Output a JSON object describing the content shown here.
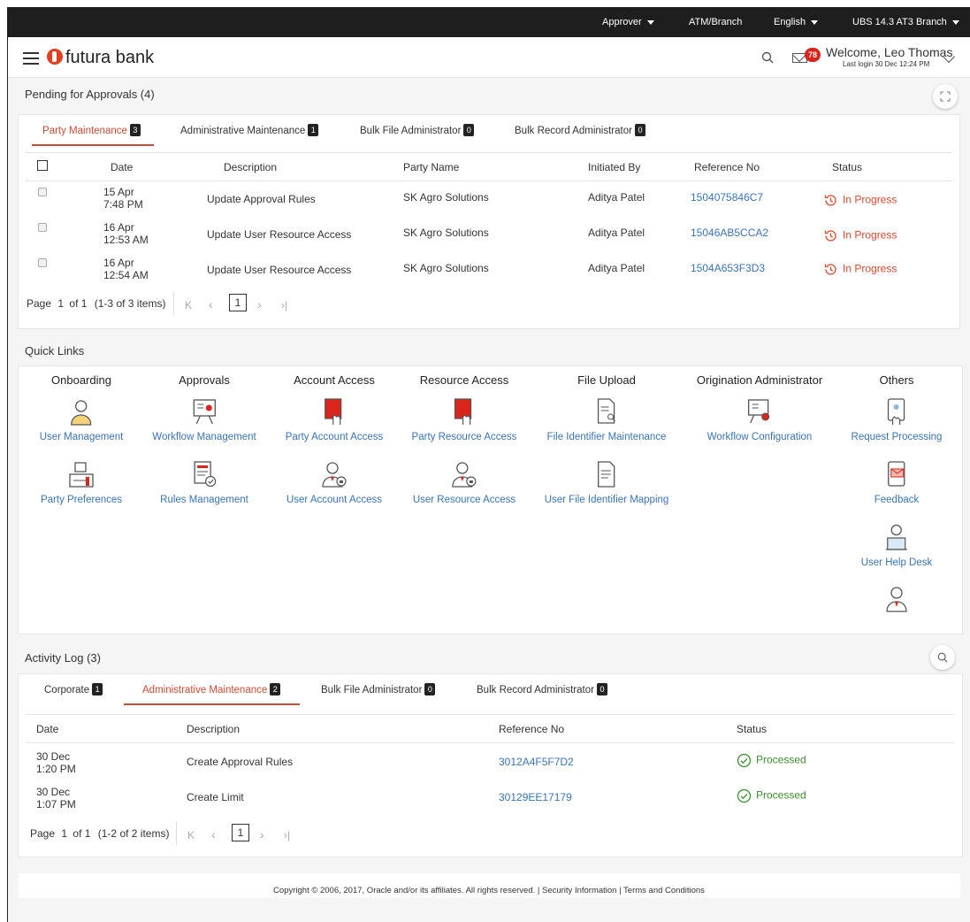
{
  "topbar": {
    "role": "Approver",
    "atm_branch": "ATM/Branch",
    "language": "English",
    "branch": "UBS 14.3 AT3 Branch"
  },
  "header": {
    "brand": "futura bank",
    "notification_count": "78",
    "welcome": "Welcome, Leo Thomas",
    "last_login": "Last login 30 Dec 12:24 PM"
  },
  "pending": {
    "title": "Pending for Approvals (4)",
    "tabs": [
      {
        "label": "Party Maintenance",
        "count": "3"
      },
      {
        "label": "Administrative Maintenance",
        "count": "1"
      },
      {
        "label": "Bulk File Administrator",
        "count": "0"
      },
      {
        "label": "Bulk Record Administrator",
        "count": "0"
      }
    ],
    "columns": [
      "Date",
      "Description",
      "Party Name",
      "Initiated By",
      "Reference No",
      "Status"
    ],
    "rows": [
      {
        "date1": "15 Apr",
        "date2": "7:48 PM",
        "description": "Update Approval Rules",
        "party": "SK Agro Solutions",
        "initiated_by": "Aditya Patel",
        "ref": "1504075846C7",
        "status": "In Progress"
      },
      {
        "date1": "16 Apr",
        "date2": "12:53 AM",
        "description": "Update User Resource Access",
        "party": "SK Agro Solutions",
        "initiated_by": "Aditya Patel",
        "ref": "15046AB5CCA2",
        "status": "In Progress"
      },
      {
        "date1": "16 Apr",
        "date2": "12:54 AM",
        "description": "Update User Resource Access",
        "party": "SK Agro Solutions",
        "initiated_by": "Aditya Patel",
        "ref": "1504A653F3D3",
        "status": "In Progress"
      }
    ],
    "pager": {
      "page_label": "Page",
      "page": "1",
      "of_label": "of 1",
      "items": "(1-3 of 3 items)",
      "current": "1"
    }
  },
  "quick_links": {
    "title": "Quick Links",
    "categories": [
      "Onboarding",
      "Approvals",
      "Account Access",
      "Resource Access",
      "File Upload",
      "Origination Administrator",
      "Others"
    ],
    "items": [
      "User Management",
      "Workflow Management",
      "Party Account Access",
      "Party Resource Access",
      "File Identifier Maintenance",
      "Workflow Configuration",
      "Request Processing",
      "Party Preferences",
      "Rules Management",
      "User Account Access",
      "User Resource Access",
      "User File Identifier Mapping",
      "Feedback",
      "User Help Desk"
    ]
  },
  "activity": {
    "title": "Activity Log (3)",
    "tabs": [
      {
        "label": "Corporate",
        "count": "1"
      },
      {
        "label": "Administrative Maintenance",
        "count": "2"
      },
      {
        "label": "Bulk File Administrator",
        "count": "0"
      },
      {
        "label": "Bulk Record Administrator",
        "count": "0"
      }
    ],
    "columns": [
      "Date",
      "Description",
      "Reference No",
      "Status"
    ],
    "rows": [
      {
        "date1": "30 Dec",
        "date2": "1:20 PM",
        "description": "Create Approval Rules",
        "ref": "3012A4F5F7D2",
        "status": "Processed"
      },
      {
        "date1": "30 Dec",
        "date2": "1:07 PM",
        "description": "Create Limit",
        "ref": "30129EE17179",
        "status": "Processed"
      }
    ],
    "pager": {
      "page_label": "Page",
      "page": "1",
      "of_label": "of 1",
      "items": "(1-2 of 2 items)",
      "current": "1"
    }
  },
  "footer": {
    "text": "Copyright © 2006, 2017, Oracle and/or its affiliates. All rights reserved. | Security Information | Terms and Conditions"
  },
  "colors": {
    "accent": "#d04a36",
    "link": "#3b73b6",
    "success": "#3c8d2f",
    "topbar": "#1e1e1e"
  }
}
